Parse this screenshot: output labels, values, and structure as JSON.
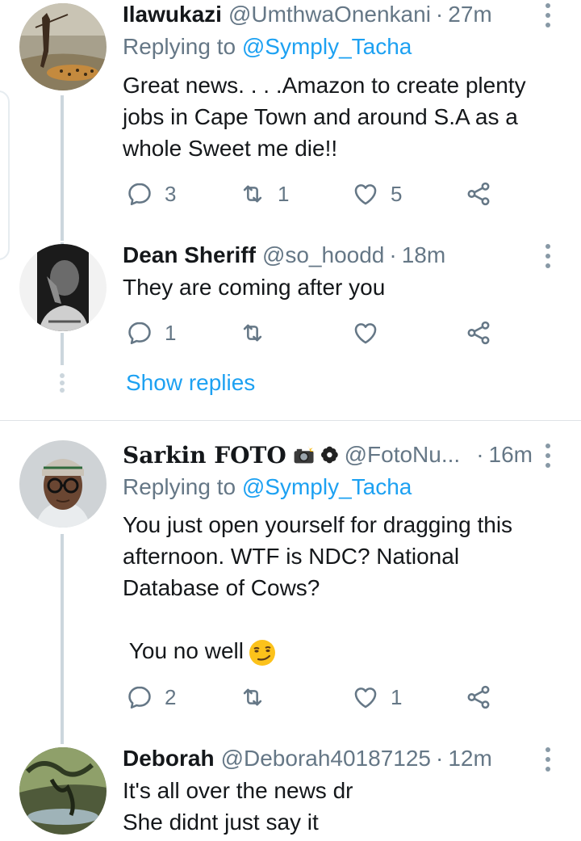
{
  "tweets": [
    {
      "name": "Ilawukazi",
      "handle": "@UmthwaOnenkani",
      "time": "27m",
      "replying_prefix": "Replying to",
      "replying_to": "@Symply_Tacha",
      "body": [
        "Great news. . . .Amazon to create plenty",
        "jobs in Cape Town and around S.A as a",
        "whole Sweet me die!!"
      ],
      "replies": "3",
      "retweets": "1",
      "likes": "5"
    },
    {
      "name": "Dean Sheriff",
      "handle": "@so_hoodd",
      "time": "18m",
      "body": [
        "They are coming after you"
      ],
      "replies": "1",
      "retweets": "",
      "likes": ""
    },
    {
      "name": "Sarkin FOTO",
      "handle": "@FotoNu...",
      "time": "16m",
      "replying_prefix": "Replying to",
      "replying_to": "@Symply_Tacha",
      "body": [
        "You just open yourself for dragging this",
        "afternoon. WTF is NDC? National",
        "Database of Cows?"
      ],
      "body_extra": " You no well",
      "replies": "2",
      "retweets": "",
      "likes": "1"
    },
    {
      "name": "Deborah",
      "handle": "@Deborah40187125",
      "time": "12m",
      "body": [
        "It's all over the news dr",
        "She didnt just say it"
      ]
    }
  ],
  "show_replies": "Show replies",
  "dot": "·",
  "icons": {
    "reply": "reply-icon",
    "retweet": "retweet-icon",
    "like": "heart-icon",
    "share": "share-icon",
    "more": "more-vertical-icon"
  },
  "colors": {
    "link": "#1da1f2",
    "secondary": "#657786",
    "thread_line": "#ccd6dd"
  }
}
